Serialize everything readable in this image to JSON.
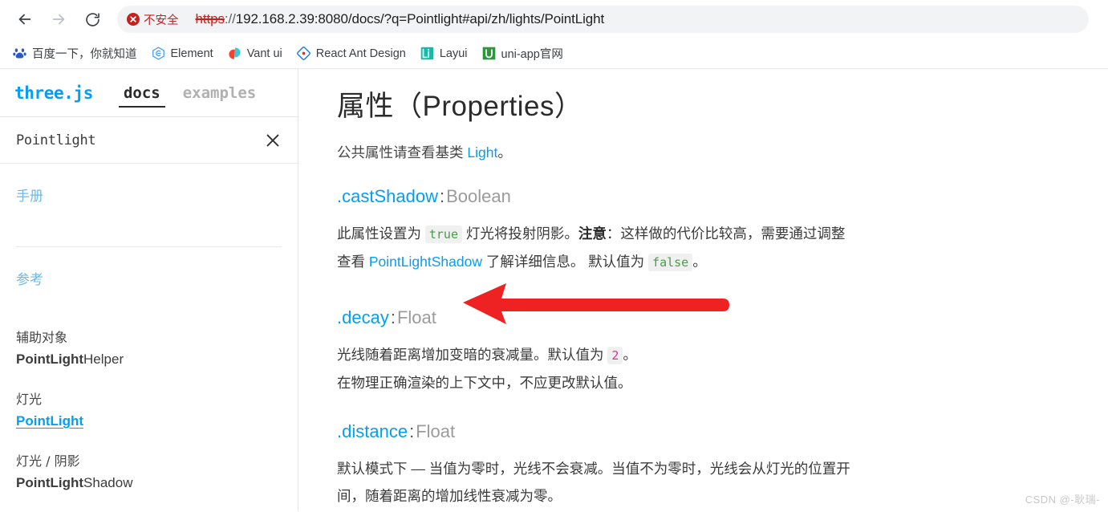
{
  "browser": {
    "nav": {
      "back_label": "Back",
      "forward_label": "Forward",
      "reload_label": "Reload"
    },
    "omnibox": {
      "security_badge": "不安全",
      "security_icon": "danger-circle-icon",
      "url_scheme": "https",
      "url_separator": "://",
      "url_rest": "192.168.2.39:8080/docs/?q=Pointlight#api/zh/lights/PointLight",
      "full_url": "https://192.168.2.39:8080/docs/?q=Pointlight#api/zh/lights/PointLight"
    },
    "bookmarks": [
      {
        "label": "百度一下，你就知道",
        "icon": "baidu-icon"
      },
      {
        "label": "Element",
        "icon": "element-icon"
      },
      {
        "label": "Vant ui",
        "icon": "vant-icon"
      },
      {
        "label": "React Ant Design",
        "icon": "antdesign-icon"
      },
      {
        "label": "Layui",
        "icon": "layui-icon"
      },
      {
        "label": "uni-app官网",
        "icon": "uniapp-icon"
      }
    ]
  },
  "sidebar": {
    "brand": "three.js",
    "tabs": [
      {
        "label": "docs",
        "active": true
      },
      {
        "label": "examples",
        "active": false
      }
    ],
    "search": {
      "value": "Pointlight",
      "placeholder": "Pointlight",
      "clear_icon": "close-icon"
    },
    "manual_link": "手册",
    "reference_link": "参考",
    "groups": [
      {
        "category": "辅助对象",
        "item_bold": "PointLight",
        "item_rest": "Helper",
        "selected": false
      },
      {
        "category": "灯光",
        "item_bold": "PointLight",
        "item_rest": "",
        "selected": true
      },
      {
        "category": "灯光 / 阴影",
        "item_bold": "PointLight",
        "item_rest": "Shadow",
        "selected": false
      }
    ]
  },
  "main": {
    "title": "属性（Properties）",
    "lead_prefix": "公共属性请查看基类 ",
    "lead_link": "Light",
    "lead_suffix": "。",
    "properties": [
      {
        "name": ".castShadow",
        "type": "Boolean",
        "line1_a": "此属性设置为 ",
        "line1_code": "true",
        "line1_b": " 灯光将投射阴影。",
        "line1_note": "注意",
        "line1_c": "：这样做的代价比较高，需要通过调整",
        "line2_a": "查看 ",
        "line2_link": "PointLightShadow",
        "line2_b": " 了解详细信息。 默认值为 ",
        "line2_code": "false",
        "line2_c": "。"
      },
      {
        "name": ".decay",
        "type": "Float",
        "line1_a": "光线随着距离增加变暗的衰减量。默认值为 ",
        "line1_code": "2",
        "line1_b": "。",
        "line2_a": "在物理正确渲染的上下文中，不应更改默认值。"
      },
      {
        "name": ".distance",
        "type": "Float",
        "line1_a": "默认模式下 — 当值为零时，光线不会衰减。当值不为零时，光线会从灯光的位置开",
        "line2_a": "间，随着距离的增加线性衰减为零。"
      }
    ],
    "annotation": {
      "type": "arrow",
      "direction": "left",
      "color": "#ee2222",
      "points_to": ".decay"
    },
    "watermark": "CSDN @-耿瑞-"
  }
}
